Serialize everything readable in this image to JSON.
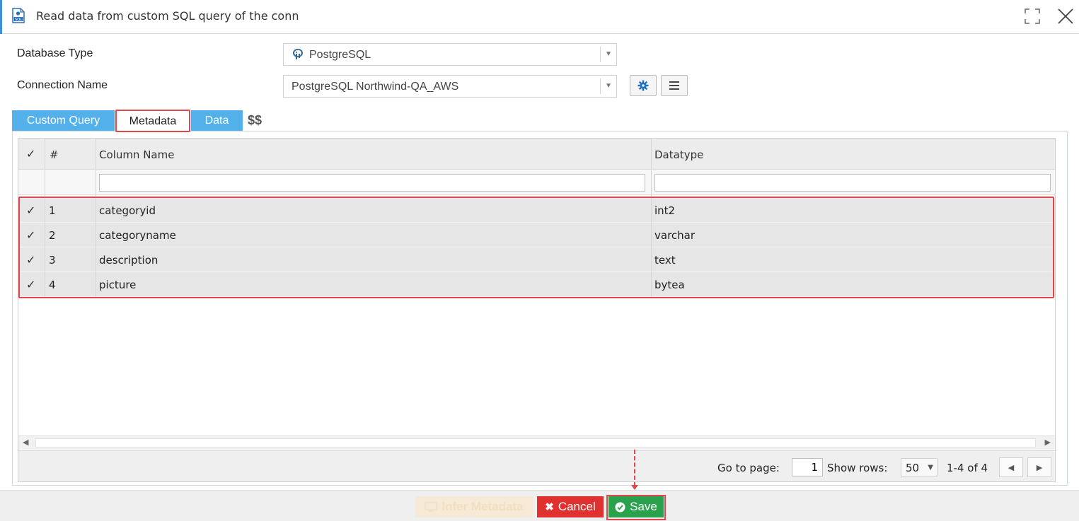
{
  "window": {
    "title": "Read data from custom SQL query of the conn",
    "file_icon": "sql-file-icon",
    "maximize_icon": "maximize-icon",
    "close_icon": "close-icon"
  },
  "form": {
    "database_type": {
      "label": "Database Type",
      "value": "PostgreSQL",
      "icon": "postgresql-elephant-icon"
    },
    "connection_name": {
      "label": "Connection Name",
      "value": "PostgreSQL Northwind-QA_AWS"
    },
    "settings_icon": "gear-icon",
    "menu_icon": "hamburger-menu-icon"
  },
  "tabs": [
    {
      "label": "Custom Query",
      "active": false
    },
    {
      "label": "Metadata",
      "active": true
    },
    {
      "label": "Data",
      "active": false
    }
  ],
  "tab_extra": "$$",
  "grid": {
    "headers": {
      "number": "#",
      "column_name": "Column Name",
      "datatype": "Datatype"
    },
    "filters": {
      "column_name": "",
      "datatype": ""
    },
    "rows": [
      {
        "num": "1",
        "column_name": "categoryid",
        "datatype": "int2",
        "checked": true
      },
      {
        "num": "2",
        "column_name": "categoryname",
        "datatype": "varchar",
        "checked": true
      },
      {
        "num": "3",
        "column_name": "description",
        "datatype": "text",
        "checked": true
      },
      {
        "num": "4",
        "column_name": "picture",
        "datatype": "bytea",
        "checked": true
      }
    ]
  },
  "pager": {
    "go_to_label": "Go to page:",
    "page": "1",
    "show_rows_label": "Show rows:",
    "rows_per_page": "50",
    "range": "1-4 of 4"
  },
  "footer": {
    "infer": "Infer Metadata",
    "cancel": "Cancel",
    "save": "Save"
  },
  "colors": {
    "tab_blue": "#53b0ea",
    "cancel_red": "#e0302f",
    "save_green": "#2aa24d",
    "highlight_red": "#e0474c",
    "accent_blue": "#3b8fd6"
  }
}
